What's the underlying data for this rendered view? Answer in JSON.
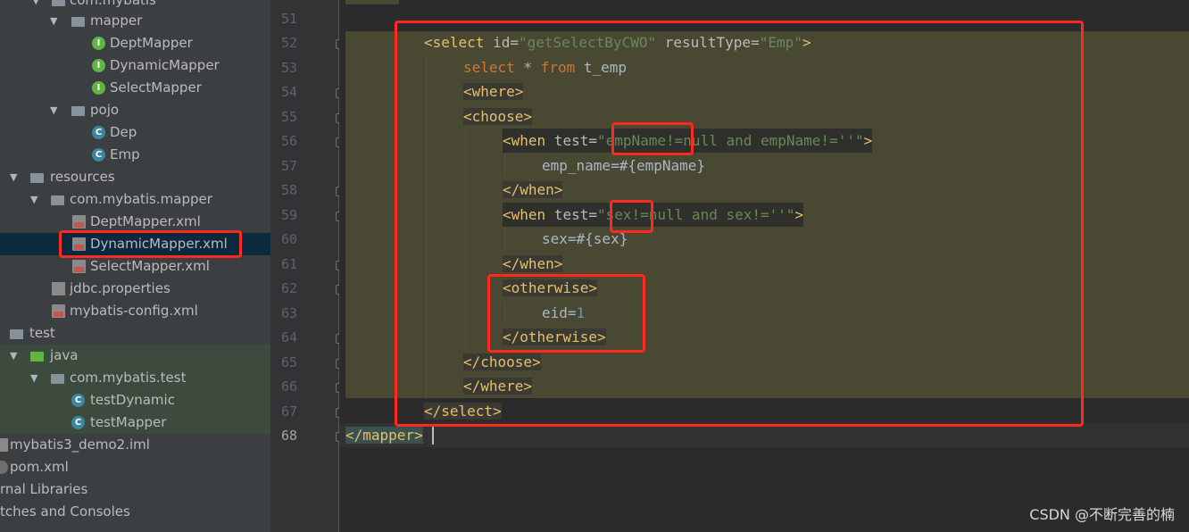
{
  "tree": {
    "items": [
      {
        "label": "com.mybatis",
        "icon": "package-folder-icon"
      },
      {
        "label": "mapper",
        "icon": "package-folder-icon"
      },
      {
        "label": "DeptMapper",
        "icon": "interface-icon"
      },
      {
        "label": "DynamicMapper",
        "icon": "interface-icon"
      },
      {
        "label": "SelectMapper",
        "icon": "interface-icon"
      },
      {
        "label": "pojo",
        "icon": "package-folder-icon"
      },
      {
        "label": "Dep",
        "icon": "class-icon"
      },
      {
        "label": "Emp",
        "icon": "class-icon"
      },
      {
        "label": "resources",
        "icon": "resources-folder-icon"
      },
      {
        "label": "com.mybatis.mapper",
        "icon": "folder-icon"
      },
      {
        "label": "DeptMapper.xml",
        "icon": "xml-file-icon"
      },
      {
        "label": "DynamicMapper.xml",
        "icon": "xml-file-icon"
      },
      {
        "label": "SelectMapper.xml",
        "icon": "xml-file-icon"
      },
      {
        "label": "jdbc.properties",
        "icon": "properties-file-icon"
      },
      {
        "label": "mybatis-config.xml",
        "icon": "xml-file-icon"
      },
      {
        "label": "test",
        "icon": "folder-icon"
      },
      {
        "label": "java",
        "icon": "test-source-folder-icon"
      },
      {
        "label": "com.mybatis.test",
        "icon": "package-folder-icon"
      },
      {
        "label": "testDynamic",
        "icon": "test-class-icon"
      },
      {
        "label": "testMapper",
        "icon": "test-class-icon"
      },
      {
        "label": "mybatis3_demo2.iml",
        "icon": "iml-file-icon"
      },
      {
        "label": "pom.xml",
        "icon": "maven-file-icon"
      },
      {
        "label": "rnal Libraries",
        "icon": ""
      },
      {
        "label": "tches and Consoles",
        "icon": ""
      }
    ]
  },
  "gutter": {
    "lines": [
      "51",
      "52",
      "53",
      "54",
      "55",
      "56",
      "57",
      "58",
      "59",
      "60",
      "61",
      "62",
      "63",
      "64",
      "65",
      "66",
      "67",
      "68"
    ]
  },
  "code": {
    "l52": {
      "open": "<select",
      "a1": " id=",
      "v1": "\"getSelectByCWO\"",
      "a2": " resultType=",
      "v2": "\"Emp\"",
      "close": ">"
    },
    "l53": {
      "k1": "select",
      "t1": " * ",
      "k2": "from",
      "t2": " t_emp"
    },
    "l54": "<where>",
    "l55": "<choose>",
    "l56": {
      "open": "<when",
      "a1": " test=",
      "v1": "\"empName!=null and empName!=''\"",
      "close": ">"
    },
    "l57": "emp_name=#{empName}",
    "l58": "</when>",
    "l59": {
      "open": "<when",
      "a1": " test=",
      "v1": "\"sex!=null and sex!=''\"",
      "close": ">"
    },
    "l60": "sex=#{sex}",
    "l61": "</when>",
    "l62": "<otherwise>",
    "l63": {
      "t": "eid=",
      "n": "1"
    },
    "l64": "</otherwise>",
    "l65": "</choose>",
    "l66": "</where>",
    "l67": "</select>",
    "l68": "</mapper>"
  },
  "watermark": "CSDN @不断完善的楠"
}
